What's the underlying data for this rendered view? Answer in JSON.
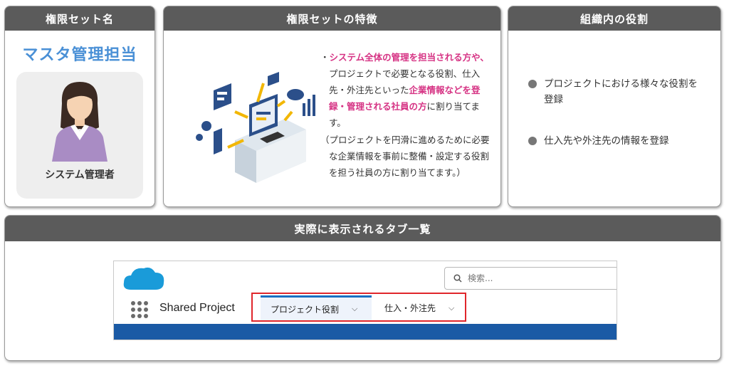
{
  "card_role_name": {
    "header": "権限セット名",
    "title": "マスタ管理担当",
    "avatar_label": "システム管理者"
  },
  "card_features": {
    "header": "権限セットの特徴",
    "bullet_mark": "・",
    "line1_pink": "システム全体の管理を担当される方や、",
    "line1_rest": "プロジェクトで必要となる役割、仕入先・外注先といった",
    "line2_pink": "企業情報などを登録・管理される社員の方",
    "line2_rest": "に割り当てます。",
    "paren": "（プロジェクトを円滑に進めるために必要な企業情報を事前に整備・設定する役割を担う社員の方に割り当てます。）"
  },
  "card_org_role": {
    "header": "組織内の役割",
    "items": [
      "プロジェクトにおける様々な役割を登録",
      "仕入先や外注先の情報を登録"
    ]
  },
  "card_tabs": {
    "header": "実際に表示されるタブ一覧",
    "search_placeholder": "検索...",
    "app_name": "Shared Project",
    "tabs": [
      {
        "label": "プロジェクト役割"
      },
      {
        "label": "仕入・外注先"
      }
    ]
  },
  "colors": {
    "header_bg": "#5b5b5b",
    "accent_blue": "#4a90d6",
    "accent_pink": "#d63384",
    "highlight_red": "#e0262b",
    "sf_blue": "#1a5aa5"
  }
}
